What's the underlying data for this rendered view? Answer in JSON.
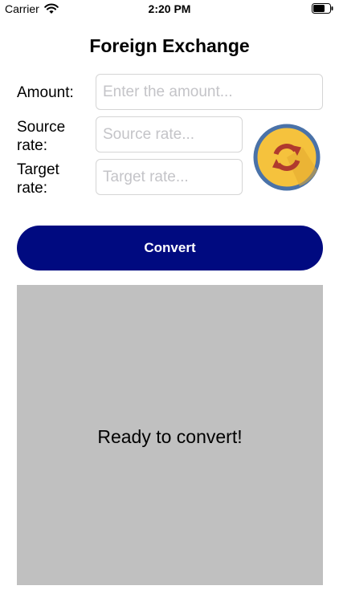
{
  "status_bar": {
    "carrier": "Carrier",
    "time": "2:20 PM"
  },
  "header": {
    "title": "Foreign Exchange"
  },
  "form": {
    "amount_label": "Amount:",
    "amount_placeholder": "Enter the amount...",
    "amount_value": "",
    "source_label": "Source\nrate:",
    "source_placeholder": "Source rate...",
    "source_value": "",
    "target_label": "Target\nrate:",
    "target_placeholder": "Target rate...",
    "target_value": ""
  },
  "swap_button": {
    "icon": "swap-rates-icon",
    "colors": {
      "fill": "#f5c23d",
      "ring": "#4a72a8",
      "arrows": "#b03a2e"
    }
  },
  "convert_button": {
    "label": "Convert",
    "color": "#000a80"
  },
  "result": {
    "text": "Ready to convert!",
    "background": "#c0c0c0"
  }
}
